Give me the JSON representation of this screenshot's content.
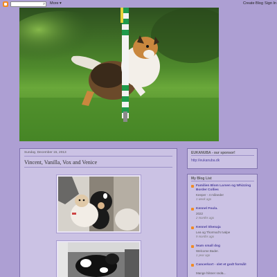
{
  "navbar": {
    "more_label": "More ▾",
    "create_blog": "Create Blog",
    "sign_in": "Sign In"
  },
  "post": {
    "date": "Sunday, December 15, 2013",
    "title": "Vincent, Vanilla, Vox and Venice"
  },
  "sponsor": {
    "title": "EUKANUBA - our sponsor!",
    "link": "http://eukanuba.dk"
  },
  "bloglist": {
    "title": "My Blog List",
    "items": [
      {
        "name": "Familien Blom Larsen og Whizzing Border Collies",
        "post": "Keeper - 4 måneder",
        "time": "1 week ago"
      },
      {
        "name": "Kennel Foula.",
        "post": "2022",
        "time": "2 months ago"
      },
      {
        "name": "Kennel Shenaja",
        "post": "Lea og Thormod's tvalpe",
        "time": "9 months ago"
      },
      {
        "name": "team small dog",
        "post": "Welcome Bader.",
        "time": "1 year ago"
      },
      {
        "name": "Cancerkort - slet et godt formål!",
        "post": "Mange hilsner snd&...",
        "time": ""
      }
    ]
  },
  "icons": {
    "blogger_logo": "blogger-logo-icon",
    "search": "search-icon"
  },
  "colors": {
    "background": "#ad9fd3",
    "panel": "#cbc2e4",
    "link": "#4b3f9c"
  }
}
